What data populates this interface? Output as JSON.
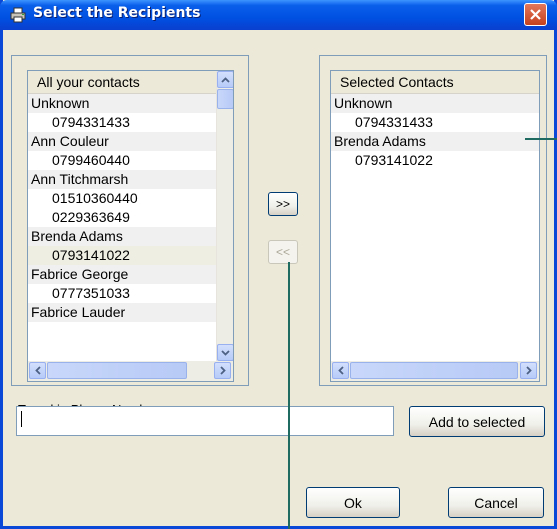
{
  "window": {
    "title": "Select the Recipients"
  },
  "all_contacts": {
    "header": "All your contacts",
    "rows": [
      {
        "text": "Unknown",
        "kind": "name"
      },
      {
        "text": "0794331433",
        "kind": "phone"
      },
      {
        "text": "Ann Couleur",
        "kind": "name"
      },
      {
        "text": "0799460440",
        "kind": "phone"
      },
      {
        "text": "Ann Titchmarsh",
        "kind": "name"
      },
      {
        "text": "01510360440",
        "kind": "phone"
      },
      {
        "text": "0229363649",
        "kind": "phone"
      },
      {
        "text": "Brenda Adams",
        "kind": "name"
      },
      {
        "text": "0793141022",
        "kind": "phone-selected"
      },
      {
        "text": "Fabrice George",
        "kind": "name"
      },
      {
        "text": "0777351033",
        "kind": "phone"
      },
      {
        "text": "Fabrice Lauder",
        "kind": "name"
      }
    ]
  },
  "selected_contacts": {
    "header": "Selected Contacts",
    "rows": [
      {
        "text": "Unknown",
        "kind": "name"
      },
      {
        "text": "0794331433",
        "kind": "phone"
      },
      {
        "text": "Brenda Adams",
        "kind": "name"
      },
      {
        "text": "0793141022",
        "kind": "phone"
      }
    ]
  },
  "transfer": {
    "add_label": ">>",
    "remove_label": "<<"
  },
  "phone_entry": {
    "label": "Typed in Phone Number:",
    "value": ""
  },
  "buttons": {
    "add_to_selected": "Add to selected",
    "ok": "Ok",
    "cancel": "Cancel"
  },
  "colors": {
    "title_bar": "#0A5FEA",
    "close_button": "#D9552F",
    "callout_line": "#1F6B62"
  },
  "icons": {
    "title": "printer-icon",
    "close": "close-icon"
  }
}
